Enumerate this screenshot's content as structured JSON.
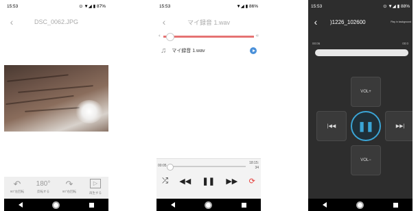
{
  "phone1": {
    "status": {
      "time": "15:53",
      "icons": "⊙ ▼◢ ▮ 87%"
    },
    "title": "DSC_0062.JPG",
    "tools": [
      {
        "icon": "↶",
        "label": "90°左回転"
      },
      {
        "icon": "180°",
        "label": "反転する"
      },
      {
        "icon": "↷",
        "label": "90°右回転"
      },
      {
        "icon": "▷",
        "label": "再生する"
      }
    ]
  },
  "phone2": {
    "status": {
      "time": "15:53",
      "icons": "▼◢ ▮ 86%"
    },
    "title": "マイ録音 1.wav",
    "track": {
      "name": "マイ録音 1.wav"
    },
    "progress": {
      "elapsed": "00:05",
      "total_line1": "18:15:",
      "total_line2": "34"
    },
    "volume_fraction": 0.03
  },
  "phone3": {
    "status": {
      "time": "15:53",
      "icons": "⊙ ▼◢ ▮ 88%"
    },
    "title": ")1226_102600",
    "bg_label": "Play in background",
    "time_left": "00:06",
    "time_right": "00:0",
    "buttons": {
      "vol_up": "VOL+",
      "vol_down": "VOL−",
      "prev": "|◀◀",
      "next": "▶▶|"
    }
  },
  "nav": {
    "back": "back-icon",
    "home": "home-icon",
    "recent": "recent-icon"
  }
}
